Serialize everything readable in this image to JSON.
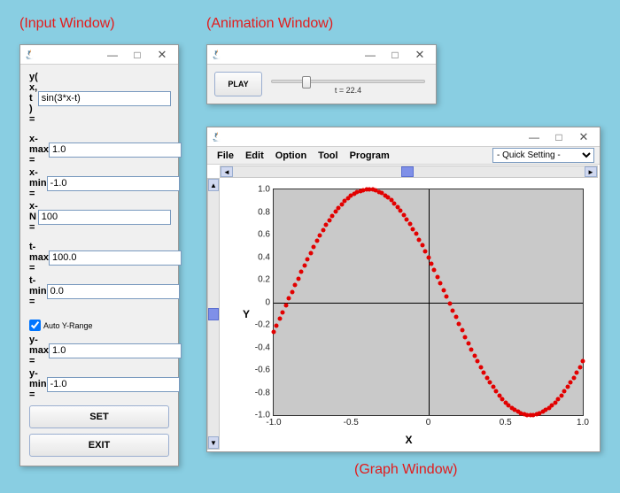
{
  "labels": {
    "input_caption": "(Input Window)",
    "anim_caption": "(Animation Window)",
    "graph_caption": "(Graph Window)"
  },
  "input": {
    "func_label": "y( x, t ) =",
    "func_value": "sin(3*x-t)",
    "xmax_label": "x-max =",
    "xmax_value": "1.0",
    "xmin_label": "x-min =",
    "xmin_value": "-1.0",
    "xn_label": "x-N =",
    "xn_value": "100",
    "tmax_label": "t-max =",
    "tmax_value": "100.0",
    "tmin_label": "t-min =",
    "tmin_value": "0.0",
    "auto_y": "Auto Y-Range",
    "ymax_label": "y-max =",
    "ymax_value": "1.0",
    "ymin_label": "y-min =",
    "ymin_value": "-1.0",
    "set_btn": "SET",
    "exit_btn": "EXIT"
  },
  "anim": {
    "play": "PLAY",
    "t_label": "t = 22.4",
    "t_value": 22.4,
    "t_max": 100.0
  },
  "graph": {
    "menu": {
      "file": "File",
      "edit": "Edit",
      "option": "Option",
      "tool": "Tool",
      "program": "Program"
    },
    "quick_setting": "- Quick Setting -",
    "xlabel": "X",
    "ylabel": "Y",
    "xticks": [
      "-1.0",
      "-0.5",
      "0",
      "0.5",
      "1.0"
    ],
    "yticks": [
      "1.0",
      "0.8",
      "0.6",
      "0.4",
      "0.2",
      "0",
      "-0.2",
      "-0.4",
      "-0.6",
      "-0.8",
      "-1.0"
    ]
  },
  "chart_data": {
    "type": "scatter",
    "title": "",
    "xlabel": "X",
    "ylabel": "Y",
    "xlim": [
      -1.0,
      1.0
    ],
    "ylim": [
      -1.0,
      1.0
    ],
    "series": [
      {
        "name": "sin(3*x - 22.4)",
        "color": "#e20000",
        "formula": "sin(3*x - t), t=22.4",
        "x_range": [
          -1.0,
          1.0
        ],
        "n": 100
      }
    ]
  }
}
